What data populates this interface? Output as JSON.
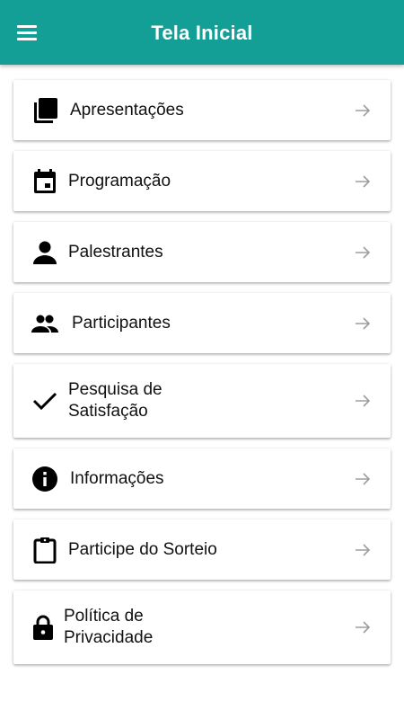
{
  "app_bar": {
    "title": "Tela Inicial",
    "menu_icon": "hamburger-menu-icon",
    "background": "#139f96"
  },
  "menu_items": [
    {
      "label": "Apresentações",
      "icon": "slides-stack-icon"
    },
    {
      "label": "Programação",
      "icon": "calendar-icon"
    },
    {
      "label": "Palestrantes",
      "icon": "person-icon"
    },
    {
      "label": "Participantes",
      "icon": "people-icon"
    },
    {
      "label": "Pesquisa de\nSatisfação",
      "icon": "checkmark-icon"
    },
    {
      "label": "Informações",
      "icon": "info-icon"
    },
    {
      "label": "Participe do Sorteio",
      "icon": "clipboard-icon"
    },
    {
      "label": "Política de\nPrivacidade",
      "icon": "lock-icon"
    }
  ],
  "arrow_icon": "arrow-right-icon",
  "arrow_color": "#9e9e9e"
}
